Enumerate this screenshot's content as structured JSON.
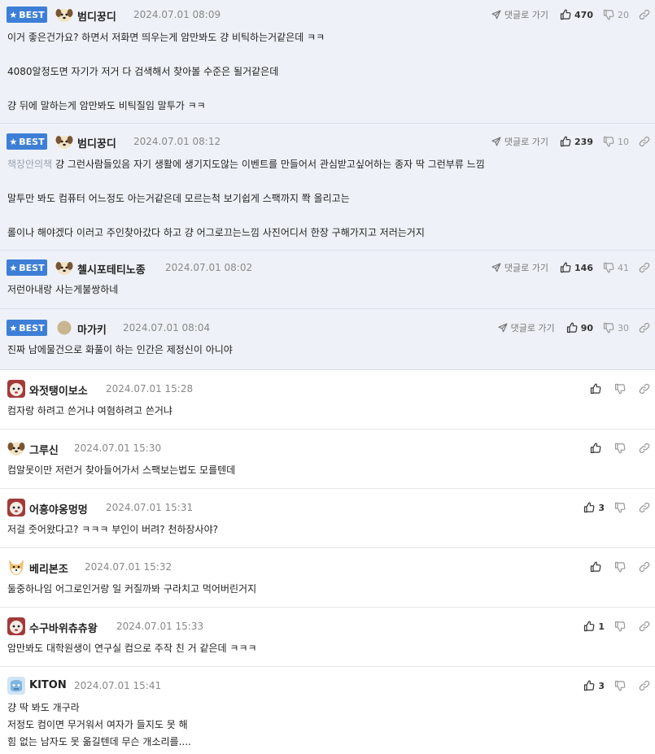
{
  "best_label": "BEST",
  "goto_label": "댓글로 가기",
  "comments": [
    {
      "best": true,
      "nick": "범디꿍디",
      "date": "2024.07.01 08:09",
      "up": "470",
      "down": "20",
      "lines": [
        "이거 좋은건가요? 하면서 저화면 띄우는게 암만봐도 걍 비틱하는거같은데 ㅋㅋ",
        "",
        "4080알정도면 자기가 저거 다 검색해서 찾아볼 수준은 될거같은데",
        "",
        "걍 뒤에 말하는게 암만봐도 비틱질임 말투가 ㅋㅋ"
      ]
    },
    {
      "best": true,
      "nick": "범디꿍디",
      "date": "2024.07.01 08:12",
      "up": "239",
      "down": "10",
      "quote": "책장안의책",
      "lines": [
        "걍 그런사람들있음 자기 생활에 생기지도않는 이벤트를 만들어서 관심받고싶어하는 종자 딱 그런부류 느낌",
        "",
        "말투만 봐도 컴퓨터 어느정도 아는거같은데 모르는척 보기쉽게 스팩까지 쫙 올리고는",
        "",
        "롤이나 해야겠다 이러고 주인찾아갔다 하고 걍 어그로끄는느낌 사진어디서 한장 구해가지고 저러는거지"
      ]
    },
    {
      "best": true,
      "nick": "첼시포테티노종",
      "date": "2024.07.01 08:02",
      "up": "146",
      "down": "41",
      "lines": [
        "저런아내랑 사는게불쌍하네"
      ]
    },
    {
      "best": true,
      "nick": "마가키",
      "date": "2024.07.01 08:04",
      "up": "90",
      "down": "30",
      "lines": [
        "진짜 남에물건으로 화풀이 하는 인간은 제정신이 아니야"
      ]
    },
    {
      "best": false,
      "nick": "와젓탱이보소",
      "date": "2024.07.01 15:28",
      "up": "",
      "down": "",
      "lines": [
        "컴자랑 하려고 쓴거냐 여혐하려고 쓴거냐"
      ]
    },
    {
      "best": false,
      "nick": "그루신",
      "date": "2024.07.01 15:30",
      "up": "",
      "down": "",
      "lines": [
        "컴알못이만 저런거 찾아들어가서 스팩보는법도 모를텐데"
      ]
    },
    {
      "best": false,
      "nick": "어흥야옹멍멍",
      "date": "2024.07.01 15:31",
      "up": "3",
      "down": "",
      "lines": [
        "저걸 줏어왔다고? ㅋㅋㅋ 부인이 버려? 천하장사야?"
      ]
    },
    {
      "best": false,
      "nick": "베리본조",
      "date": "2024.07.01 15:32",
      "up": "",
      "down": "",
      "lines": [
        "둘중하나임 어그로인거랑 일 커질까봐 구라치고 먹어버린거지"
      ]
    },
    {
      "best": false,
      "nick": "수구바위츄츄왕",
      "date": "2024.07.01 15:33",
      "up": "1",
      "down": "",
      "lines": [
        "암만봐도 대학원생이 연구실 컴으로 주작 친 거 같은데 ㅋㅋㅋ"
      ]
    },
    {
      "best": false,
      "nick": "KITON",
      "date": "2024.07.01 15:41",
      "up": "3",
      "down": "",
      "lines": [
        "걍 딱 봐도 개구라",
        "저정도 컴이면 무거워서 여자가 들지도 못 해",
        "힘 없는 남자도 못 옮길텐데 무슨 개소리를...."
      ]
    }
  ]
}
